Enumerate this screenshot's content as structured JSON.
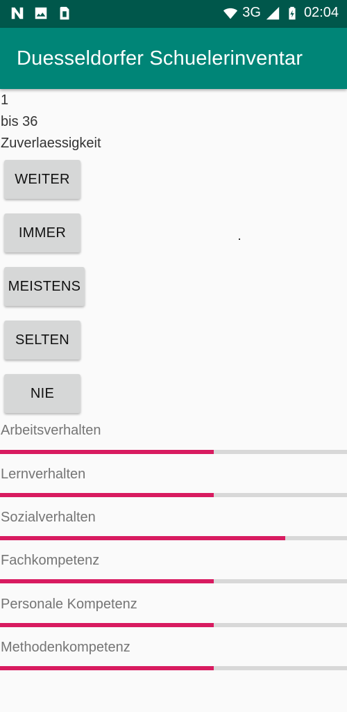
{
  "statusbar": {
    "time": "02:04",
    "network": "3G",
    "icons_left": [
      "n-notification-icon",
      "image-icon",
      "sim-icon"
    ],
    "icons_right": [
      "wifi-icon",
      "signal-icon",
      "battery-charging-icon"
    ]
  },
  "appbar": {
    "title": "Duesseldorfer Schuelerinventar"
  },
  "info": {
    "line1": "1",
    "line2": "bis 36",
    "line3": "Zuverlaessigkeit"
  },
  "buttons": {
    "weiter": "WEITER",
    "immer": "IMMER",
    "meistens": "MEISTENS",
    "selten": "SELTEN",
    "nie": "NIE"
  },
  "categories": [
    {
      "label": "Arbeitsverhalten",
      "progress": 0.616
    },
    {
      "label": "Lernverhalten",
      "progress": 0.616
    },
    {
      "label": "Sozialverhalten",
      "progress": 0.822
    },
    {
      "label": "Fachkompetenz",
      "progress": 0.616
    },
    {
      "label": "Personale Kompetenz",
      "progress": 0.616
    },
    {
      "label": "Methodenkompetenz",
      "progress": 0.616
    }
  ],
  "colors": {
    "statusbar": "#00574b",
    "appbar": "#008577",
    "accent": "#d81b60",
    "track": "#d8d8d8",
    "button": "#d6d7d7"
  }
}
